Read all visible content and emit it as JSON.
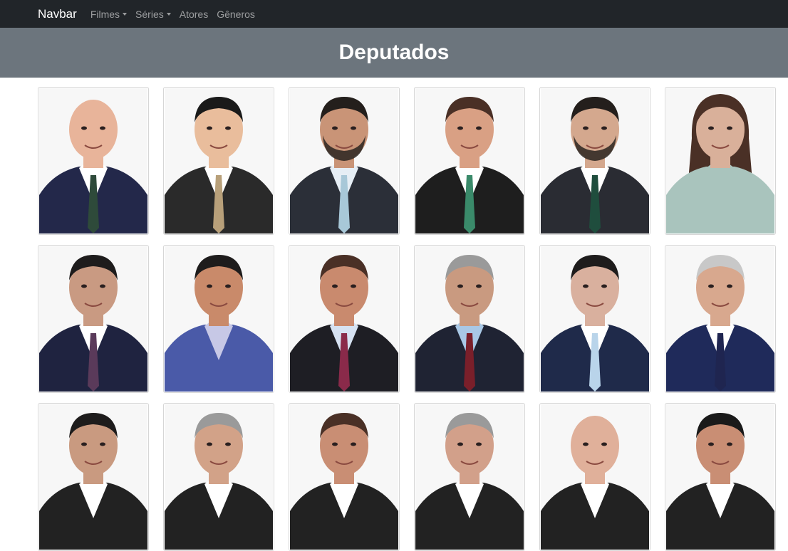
{
  "navbar": {
    "brand": "Navbar",
    "items": [
      {
        "label": "Filmes",
        "dropdown": true
      },
      {
        "label": "Séries",
        "dropdown": true
      },
      {
        "label": "Atores",
        "dropdown": false
      },
      {
        "label": "Gêneros",
        "dropdown": false
      }
    ]
  },
  "page": {
    "title": "Deputados"
  },
  "deputies": [
    {
      "photo": "portrait-photo",
      "hair": "bald",
      "skin": "#e8b49a",
      "suit": "#23284a",
      "shirt": "#ffffff",
      "tie": "#2e4a3a"
    },
    {
      "photo": "portrait-photo",
      "hair": "dark-short",
      "skin": "#e9bd9c",
      "suit": "#2a2a2a",
      "shirt": "#ffffff",
      "tie": "#b8a07a"
    },
    {
      "photo": "portrait-photo",
      "hair": "dark-beard",
      "skin": "#c99477",
      "suit": "#2b2f38",
      "shirt": "#e6eef5",
      "tie": "#a8c8d8"
    },
    {
      "photo": "portrait-photo",
      "hair": "brown",
      "skin": "#d9a084",
      "suit": "#1e1e1e",
      "shirt": "#ffffff",
      "tie": "#3a8a6a"
    },
    {
      "photo": "portrait-photo",
      "hair": "dark-beard",
      "skin": "#d4a88e",
      "suit": "#2a2c33",
      "shirt": "#ffffff",
      "tie": "#1f4d3d"
    },
    {
      "photo": "portrait-photo",
      "hair": "long-brown",
      "skin": "#d9b09a",
      "suit": "#a9c4bd",
      "shirt": "#a9c4bd",
      "tie": ""
    },
    {
      "photo": "portrait-photo",
      "hair": "dark",
      "skin": "#c99a82",
      "suit": "#1f2340",
      "shirt": "#ffffff",
      "tie": "#5a3a5a"
    },
    {
      "photo": "portrait-photo",
      "hair": "dark",
      "skin": "#c98a6a",
      "suit": "#4a5aa8",
      "shirt": "#c7c8e6",
      "tie": ""
    },
    {
      "photo": "portrait-photo",
      "hair": "brown",
      "skin": "#c98a6e",
      "suit": "#1e1e24",
      "shirt": "#d6e2f2",
      "tie": "#8a2a4a"
    },
    {
      "photo": "portrait-photo",
      "hair": "gray",
      "skin": "#c99a80",
      "suit": "#1f2333",
      "shirt": "#a9c8e6",
      "tie": "#7a1f2a"
    },
    {
      "photo": "portrait-photo",
      "hair": "dark",
      "skin": "#d9b09e",
      "suit": "#1f2a4a",
      "shirt": "#ffffff",
      "tie": "#b9d4ea"
    },
    {
      "photo": "portrait-photo",
      "hair": "white",
      "skin": "#d8a88e",
      "suit": "#1f2a5a",
      "shirt": "#ffffff",
      "tie": "#1f2550"
    },
    {
      "photo": "portrait-photo",
      "hair": "dark",
      "skin": "#c99a80",
      "suit": "#222",
      "shirt": "#fff",
      "tie": ""
    },
    {
      "photo": "portrait-photo",
      "hair": "gray",
      "skin": "#d2a288",
      "suit": "#222",
      "shirt": "#fff",
      "tie": ""
    },
    {
      "photo": "portrait-photo",
      "hair": "brown",
      "skin": "#c98e74",
      "suit": "#222",
      "shirt": "#fff",
      "tie": ""
    },
    {
      "photo": "portrait-photo",
      "hair": "gray",
      "skin": "#d2a08a",
      "suit": "#222",
      "shirt": "#fff",
      "tie": ""
    },
    {
      "photo": "portrait-photo",
      "hair": "bald",
      "skin": "#e0b09a",
      "suit": "#222",
      "shirt": "#fff",
      "tie": ""
    },
    {
      "photo": "portrait-photo",
      "hair": "curly-dark",
      "skin": "#c98e74",
      "suit": "#222",
      "shirt": "#fff",
      "tie": ""
    }
  ],
  "colors": {
    "navbar_bg": "#212529",
    "hero_bg": "#6c757d",
    "card_border": "#d6d6d6"
  }
}
